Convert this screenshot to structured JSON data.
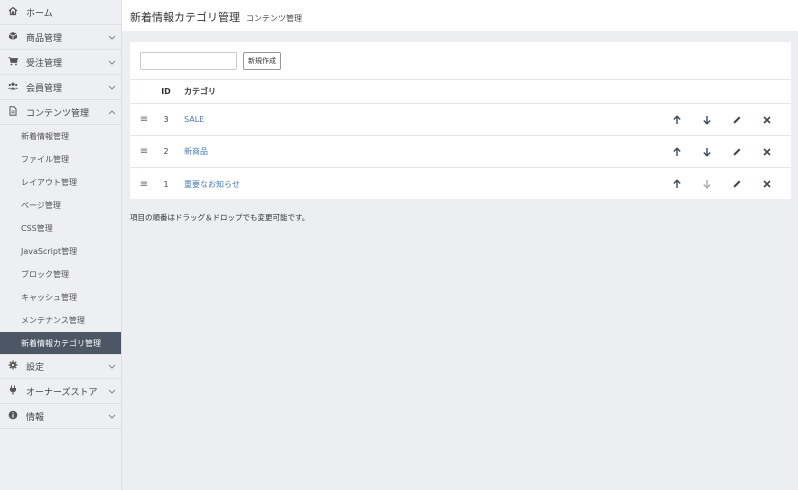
{
  "sidebar": {
    "home": {
      "label": "ホーム",
      "icon": "home-icon"
    },
    "product": {
      "label": "商品管理",
      "icon": "cube-icon"
    },
    "order": {
      "label": "受注管理",
      "icon": "cart-icon"
    },
    "customer": {
      "label": "会員管理",
      "icon": "users-icon"
    },
    "content": {
      "label": "コンテンツ管理",
      "icon": "file-icon"
    },
    "content_items": [
      {
        "label": "新着情報管理"
      },
      {
        "label": "ファイル管理"
      },
      {
        "label": "レイアウト管理"
      },
      {
        "label": "ページ管理"
      },
      {
        "label": "CSS管理"
      },
      {
        "label": "JavaScript管理"
      },
      {
        "label": "ブロック管理"
      },
      {
        "label": "キャッシュ管理"
      },
      {
        "label": "メンテナンス管理"
      },
      {
        "label": "新着情報カテゴリ管理"
      }
    ],
    "setting": {
      "label": "設定",
      "icon": "gear-icon"
    },
    "store": {
      "label": "オーナーズストア",
      "icon": "plug-icon"
    },
    "info": {
      "label": "情報",
      "icon": "info-icon"
    }
  },
  "header": {
    "title": "新着情報カテゴリ管理",
    "subtitle": "コンテンツ管理"
  },
  "toolbar": {
    "input_value": "",
    "create_label": "新規作成"
  },
  "table": {
    "headers": {
      "id": "ID",
      "category": "カテゴリ"
    },
    "rows": [
      {
        "id": "3",
        "category": "SALE"
      },
      {
        "id": "2",
        "category": "新商品"
      },
      {
        "id": "1",
        "category": "重要なお知らせ"
      }
    ]
  },
  "note": "項目の順番はドラッグ＆ドロップでも変更可能です。",
  "colors": {
    "accent_link": "#4a7ab5",
    "active_nav": "#4c5665",
    "icon": "#3c4a5a"
  }
}
